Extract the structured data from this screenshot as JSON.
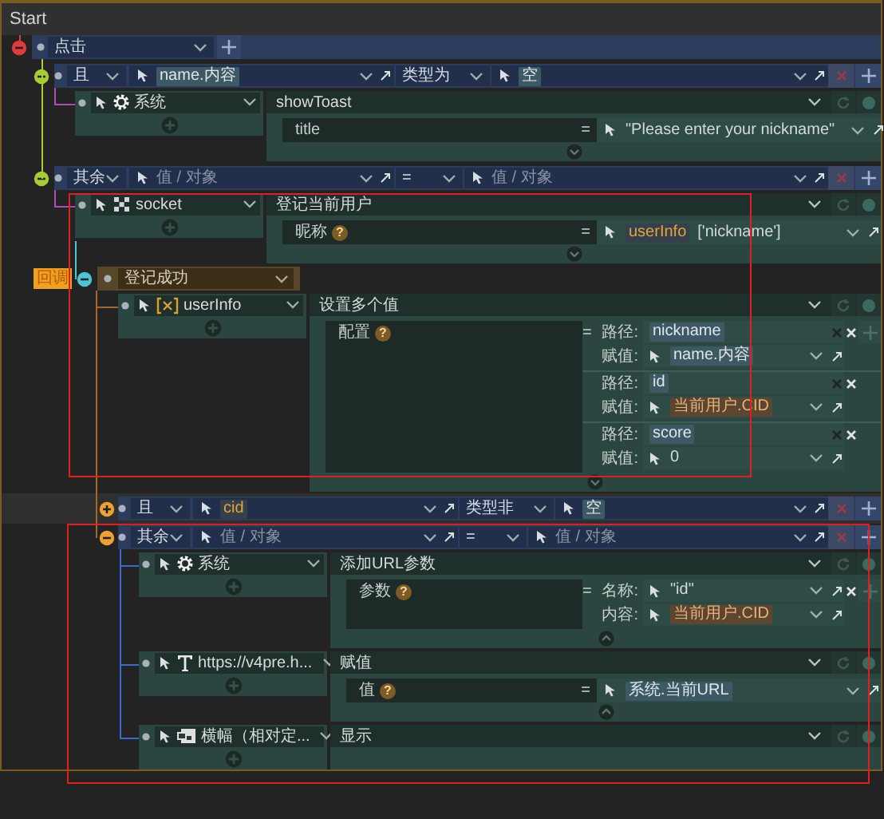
{
  "window": {
    "title": "Start"
  },
  "event": {
    "trigger": "点击",
    "branches": [
      {
        "logic": "且",
        "expanded": true,
        "left": {
          "parts": [
            {
              "text": "name.内容",
              "kind": "chip"
            }
          ]
        },
        "operator": "类型为",
        "right": {
          "parts": [
            {
              "text": "空",
              "kind": "chip"
            }
          ]
        },
        "actions": [
          {
            "target": "系统",
            "kind": "system",
            "method": "showToast",
            "expanded": false,
            "params": [
              {
                "kind": "value",
                "label": "title",
                "sign": "=",
                "value": {
                  "parts": [
                    {
                      "text": "\"Please enter your nickname\"",
                      "kind": "plain"
                    }
                  ]
                }
              }
            ]
          }
        ]
      },
      {
        "logic": "其余",
        "expanded": true,
        "left": {
          "placeholder": "值 / 对象"
        },
        "operator": "=",
        "right": {
          "placeholder": "值 / 对象"
        },
        "actions": [
          {
            "target": "socket",
            "kind": "socket",
            "method": "登记当前用户",
            "expanded": false,
            "highlighted": true,
            "params": [
              {
                "kind": "value",
                "label": "昵称",
                "help": "?",
                "sign": "=",
                "value": {
                  "parts": [
                    {
                      "text": "userInfo",
                      "kind": "variable"
                    },
                    {
                      "text": "['nickname']",
                      "kind": "plain"
                    }
                  ]
                }
              }
            ],
            "callback": {
              "tag": "回调",
              "name": "登记成功",
              "actions": [
                {
                  "target": "userInfo",
                  "kind": "variable",
                  "method": "设置多个值",
                  "expanded": false,
                  "params": [
                    {
                      "kind": "groups",
                      "label": "配置",
                      "help": "?",
                      "sign": "=",
                      "groups": [
                        {
                          "add": true,
                          "fields": [
                            {
                              "label": "路径:",
                              "kind": "input",
                              "removable": true,
                              "value": {
                                "parts": [
                                  {
                                    "text": "nickname",
                                    "kind": "chip"
                                  }
                                ]
                              }
                            },
                            {
                              "label": "赋值:",
                              "kind": "picker",
                              "value": {
                                "parts": [
                                  {
                                    "text": "name.内容",
                                    "kind": "chip"
                                  }
                                ]
                              }
                            }
                          ]
                        },
                        {
                          "add": false,
                          "fields": [
                            {
                              "label": "路径:",
                              "kind": "input",
                              "removable": true,
                              "value": {
                                "parts": [
                                  {
                                    "text": "id",
                                    "kind": "chip"
                                  }
                                ]
                              }
                            },
                            {
                              "label": "赋值:",
                              "kind": "picker",
                              "value": {
                                "parts": [
                                  {
                                    "text": "当前用户.CID",
                                    "kind": "data"
                                  }
                                ]
                              }
                            }
                          ]
                        },
                        {
                          "add": false,
                          "fields": [
                            {
                              "label": "路径:",
                              "kind": "input",
                              "removable": true,
                              "value": {
                                "parts": [
                                  {
                                    "text": "score",
                                    "kind": "chip"
                                  }
                                ]
                              }
                            },
                            {
                              "label": "赋值:",
                              "kind": "picker",
                              "value": {
                                "parts": [
                                  {
                                    "text": "0",
                                    "kind": "plain"
                                  }
                                ]
                              }
                            }
                          ]
                        }
                      ]
                    }
                  ]
                }
              ],
              "branches": [
                {
                  "logic": "且",
                  "expanded": false,
                  "hovered": true,
                  "left": {
                    "parts": [
                      {
                        "text": "cid",
                        "kind": "variable"
                      }
                    ]
                  },
                  "operator": "类型非",
                  "right": {
                    "parts": [
                      {
                        "text": "空",
                        "kind": "chip"
                      }
                    ]
                  }
                },
                {
                  "logic": "其余",
                  "expanded": true,
                  "highlighted": true,
                  "left": {
                    "placeholder": "值 / 对象"
                  },
                  "operator": "=",
                  "right": {
                    "placeholder": "值 / 对象"
                  },
                  "actions": [
                    {
                      "target": "系统",
                      "kind": "system",
                      "method": "添加URL参数",
                      "expanded": true,
                      "params": [
                        {
                          "kind": "groups",
                          "label": "参数",
                          "help": "?",
                          "sign": "=",
                          "groups": [
                            {
                              "add": true,
                              "fields": [
                                {
                                  "label": "名称:",
                                  "kind": "picker",
                                  "removable": true,
                                  "value": {
                                    "parts": [
                                      {
                                        "text": "\"id\"",
                                        "kind": "plain"
                                      }
                                    ]
                                  }
                                },
                                {
                                  "label": "内容:",
                                  "kind": "picker",
                                  "value": {
                                    "parts": [
                                      {
                                        "text": "当前用户.CID",
                                        "kind": "data"
                                      }
                                    ]
                                  }
                                }
                              ]
                            }
                          ]
                        }
                      ]
                    },
                    {
                      "target": "https://v4pre.h...",
                      "kind": "text",
                      "method": "赋值",
                      "expanded": true,
                      "params": [
                        {
                          "kind": "value",
                          "label": "值",
                          "help": "?",
                          "sign": "=",
                          "value": {
                            "parts": [
                              {
                                "text": "系统.当前URL",
                                "kind": "chip"
                              }
                            ]
                          }
                        }
                      ]
                    },
                    {
                      "target": "横幅（相对定...",
                      "kind": "banner",
                      "method": "显示"
                    }
                  ]
                }
              ]
            }
          }
        ]
      }
    ]
  }
}
